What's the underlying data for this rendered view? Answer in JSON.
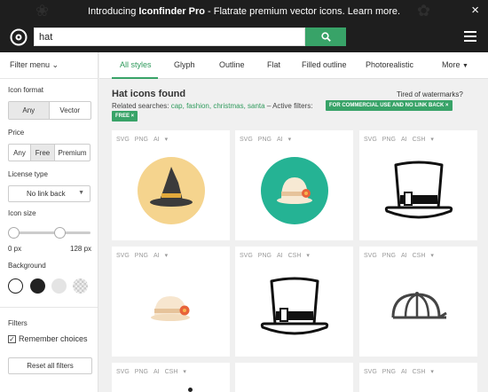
{
  "banner": {
    "intro": "Introducing ",
    "brand": "Iconfinder Pro",
    "rest": " - Flatrate premium vector icons. Learn more.",
    "close": "×"
  },
  "search": {
    "value": "hat"
  },
  "sidebar": {
    "filter_menu": "Filter menu",
    "icon_format": {
      "label": "Icon format",
      "options": [
        "Any",
        "Vector"
      ],
      "selected": "Any"
    },
    "price": {
      "label": "Price",
      "options": [
        "Any",
        "Free",
        "Premium"
      ],
      "selected": "Free"
    },
    "license": {
      "label": "License type",
      "value": "No link back"
    },
    "icon_size": {
      "label": "Icon size",
      "min": "0 px",
      "max": "128 px"
    },
    "background": {
      "label": "Background"
    },
    "filters": {
      "label": "Filters",
      "remember": "Remember choices",
      "checked": true
    },
    "reset": "Reset all filters"
  },
  "tabs": [
    "All styles",
    "Glyph",
    "Outline",
    "Flat",
    "Filled outline",
    "Photorealistic",
    "More"
  ],
  "results": {
    "title": "Hat icons found",
    "tired": "Tired of watermarks?",
    "related_prefix": "Related searches:",
    "related": [
      "cap,",
      "fashion,",
      "christmas,",
      "santa"
    ],
    "active_filters": "– Active filters:",
    "badges": [
      "FOR COMMERCIAL USE AND NO LINK BACK ×",
      "FREE ×"
    ]
  },
  "cards": [
    {
      "formats": [
        "SVG",
        "PNG",
        "AI",
        "▾"
      ],
      "icon": "witch-hat-icon"
    },
    {
      "formats": [
        "SVG",
        "PNG",
        "AI",
        "▾"
      ],
      "icon": "cloche-hat-flower-icon"
    },
    {
      "formats": [
        "SVG",
        "PNG",
        "AI",
        "CSH",
        "▾"
      ],
      "icon": "top-hat-outline-icon"
    },
    {
      "formats": [
        "SVG",
        "PNG",
        "AI",
        "▾"
      ],
      "icon": "cloche-hat-small-icon"
    },
    {
      "formats": [
        "SVG",
        "PNG",
        "AI",
        "CSH",
        "▾"
      ],
      "icon": "top-hat-outline-icon"
    },
    {
      "formats": [
        "SVG",
        "PNG",
        "AI",
        "CSH",
        "▾"
      ],
      "icon": "cap-outline-icon"
    },
    {
      "formats": [
        "SVG",
        "PNG",
        "AI",
        "CSH",
        "▾"
      ],
      "icon": "hat-partial-icon"
    },
    {
      "formats": [],
      "icon": ""
    },
    {
      "formats": [
        "SVG",
        "PNG",
        "AI",
        "CSH",
        "▾"
      ],
      "icon": ""
    }
  ],
  "colors": {
    "accent": "#38a368",
    "banner": "#1e1e1e",
    "witch_bg": "#f5d48e",
    "teal_bg": "#25b394"
  }
}
